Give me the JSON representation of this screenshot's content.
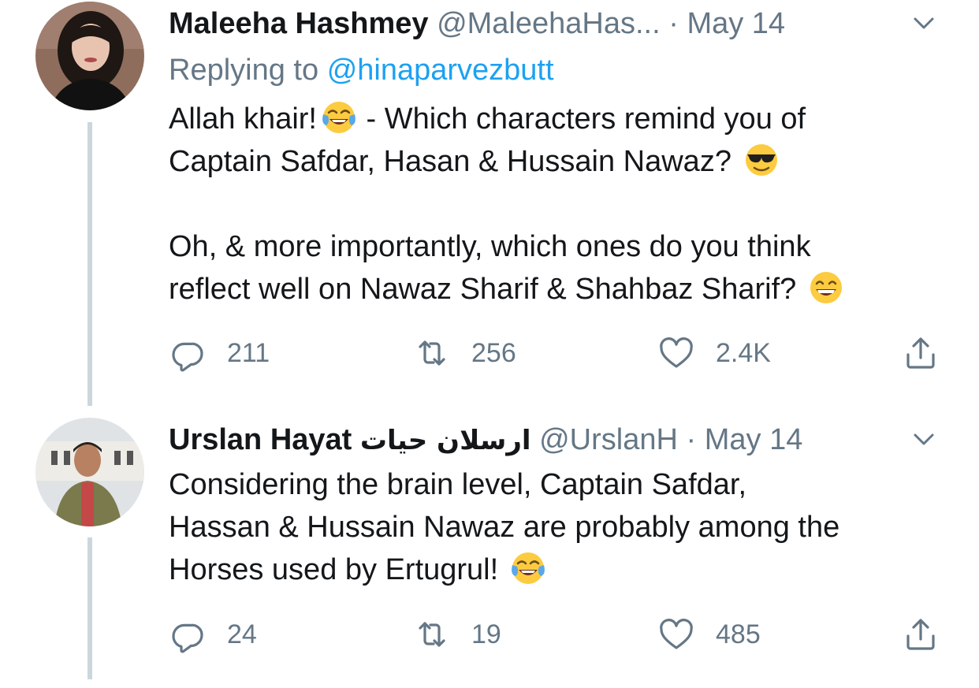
{
  "tweets": [
    {
      "name": "Maleeha Hashmey",
      "handle": "@MaleehaHas...",
      "separator": "·",
      "date": "May 14",
      "replying_prefix": "Replying to",
      "replying_to": "@hinaparvezbutt",
      "line1_a": "Allah khair!",
      "line1_b": " - Which characters remind you of",
      "line2": "Captain Safdar, Hasan & Hussain Nawaz?",
      "line3": "Oh, & more importantly, which ones do you think",
      "line4": "reflect well on Nawaz Sharif & Shahbaz Sharif?",
      "replies": "211",
      "retweets": "256",
      "likes": "2.4K"
    },
    {
      "name": "Urslan Hayat",
      "name_urdu": "ارسلان حیات",
      "handle": "@UrslanH",
      "separator": "·",
      "date": "May 14",
      "line1": "Considering the brain level, Captain Safdar,",
      "line2": "Hassan & Hussain Nawaz are probably among the",
      "line3": "Horses used by Ertugrul!",
      "replies": "24",
      "retweets": "19",
      "likes": "485"
    }
  ],
  "icons": {
    "reply": "reply-icon",
    "retweet": "retweet-icon",
    "like": "heart-icon",
    "share": "share-icon",
    "caret": "chevron-down-icon"
  },
  "colors": {
    "text": "#14171a",
    "muted": "#657786",
    "link": "#1da1f2",
    "thread": "#ccd6dd"
  }
}
